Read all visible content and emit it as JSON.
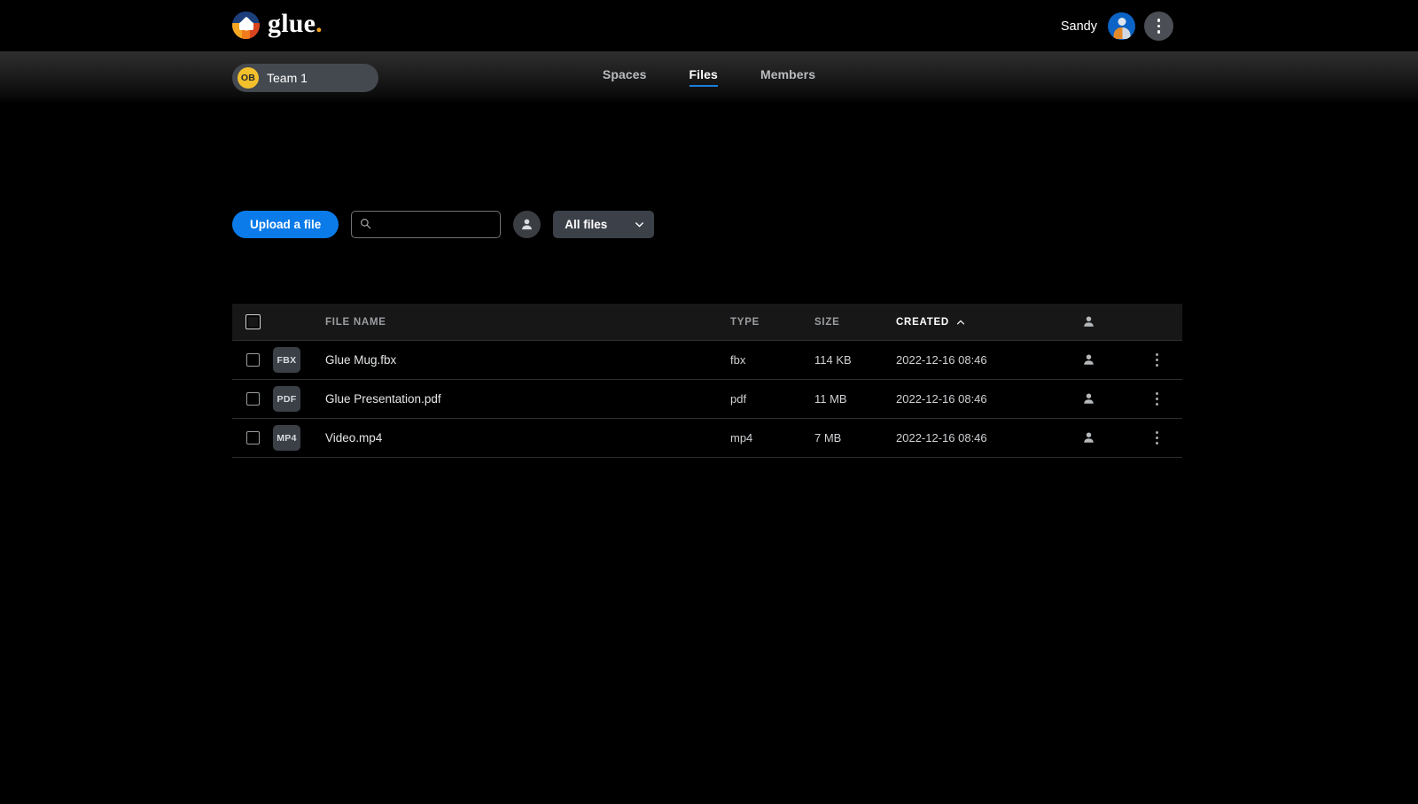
{
  "topbar": {
    "logo_text": "glue",
    "logo_dot": ".",
    "logo_icon": "glue-cube-logo",
    "user_name": "Sandy",
    "avatar_icon": "user-avatar-icon",
    "menu_icon": "kebab-menu-icon"
  },
  "subnav": {
    "team": {
      "initials": "OB",
      "name": "Team 1"
    },
    "tabs": [
      {
        "label": "Spaces",
        "active": false
      },
      {
        "label": "Files",
        "active": true
      },
      {
        "label": "Members",
        "active": false
      }
    ]
  },
  "toolbar": {
    "upload_label": "Upload a file",
    "search_value": "",
    "search_placeholder": "",
    "search_icon": "search-icon",
    "person_filter_icon": "person-filter-icon",
    "filter_label": "All files",
    "filter_chevron": "chevron-down-icon"
  },
  "table": {
    "headers": {
      "file_name": "FILE NAME",
      "type": "TYPE",
      "size": "SIZE",
      "created": "CREATED",
      "owner_icon": "person-icon"
    },
    "sort": {
      "column": "CREATED",
      "direction": "ascending",
      "icon": "caret-up-icon"
    },
    "rows": [
      {
        "badge": "FBX",
        "name": "Glue Mug.fbx",
        "type": "fbx",
        "size": "114 KB",
        "created": "2022-12-16 08:46",
        "owner_icon": "person-icon",
        "menu_icon": "row-kebab-icon"
      },
      {
        "badge": "PDF",
        "name": "Glue Presentation.pdf",
        "type": "pdf",
        "size": "11 MB",
        "created": "2022-12-16 08:46",
        "owner_icon": "person-icon",
        "menu_icon": "row-kebab-icon"
      },
      {
        "badge": "MP4",
        "name": "Video.mp4",
        "type": "mp4",
        "size": "7 MB",
        "created": "2022-12-16 08:46",
        "owner_icon": "person-icon",
        "menu_icon": "row-kebab-icon"
      }
    ]
  },
  "colors": {
    "background": "#000000",
    "accent_blue": "#0b7bea",
    "tab_underline": "#1a7fe0",
    "team_badge": "#f3c02c",
    "logo_dot": "#f5a623",
    "header_row": "#171717",
    "divider": "#2e2e2e"
  }
}
